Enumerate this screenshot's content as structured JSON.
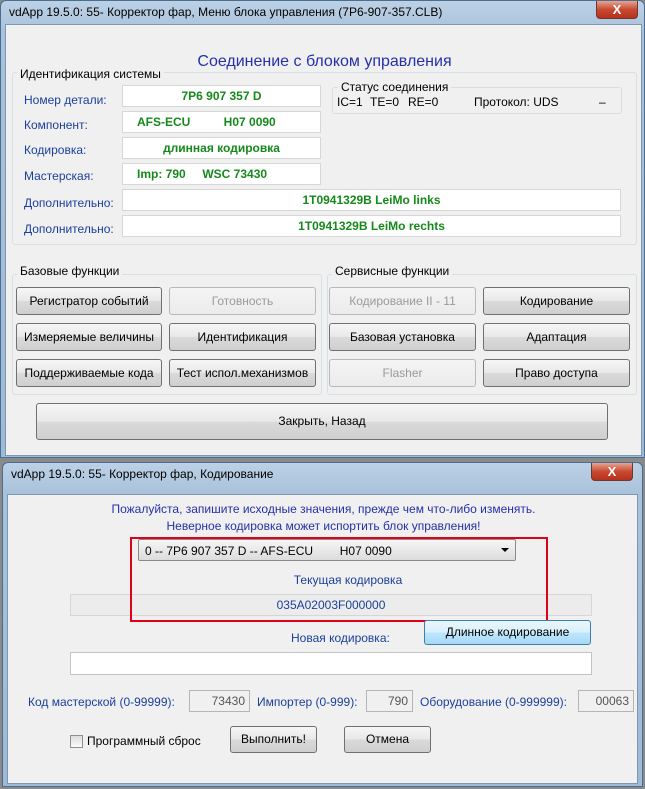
{
  "window1": {
    "title": "vdApp 19.5.0: 55- Корректор фар,  Меню блока управления (7P6-907-357.CLB)",
    "close": "X",
    "heading": "Соединение с блоком управления",
    "ident_group": "Идентификация системы",
    "status_group": "Статус соединения",
    "status_line": {
      "ic": "IC=1",
      "te": "TE=0",
      "re": "RE=0",
      "protocol": "Протокол: UDS",
      "dash": "–"
    },
    "fields": [
      {
        "label": "Номер детали:",
        "value": "7P6 907 357 D"
      },
      {
        "label": "Компонент:",
        "value": "AFS-ECU          H07 0090"
      },
      {
        "label": "Кодировка:",
        "value": "длинная кодировка"
      },
      {
        "label": "Мастерская:",
        "value": "Imp: 790     WSC 73430"
      },
      {
        "label": "Дополнительно:",
        "value": "1T0941329B LeiMo links"
      },
      {
        "label": "Дополнительно:",
        "value": "1T0941329B LeiMo rechts"
      }
    ],
    "basic_group": "Базовые функции",
    "service_group": "Сервисные функции",
    "buttons": {
      "event_log": "Регистратор событий",
      "readiness": "Готовность",
      "coding2": "Кодирование II - 11",
      "coding": "Кодирование",
      "measured": "Измеряемые величины",
      "identification": "Идентификация",
      "basic_setting": "Базовая установка",
      "adaptation": "Адаптация",
      "supported_codes": "Поддерживаемые кода",
      "actuator_test": "Тест испол.механизмов",
      "flasher": "Flasher",
      "access": "Право доступа",
      "close_back": "Закрыть, Назад"
    }
  },
  "window2": {
    "title": "vdApp 19.5.0: 55- Корректор фар,  Кодирование",
    "close": "X",
    "warning1": "Пожалуйста, запишите исходные значения, прежде чем что-либо изменять.",
    "warning2": "Неверное кодировка может испортить блок управления!",
    "dropdown": "0 -- 7P6 907 357 D -- AFS-ECU        H07 0090",
    "current_label": "Текущая кодировка",
    "current_value": "035A02003F000000",
    "new_label": "Новая кодировка:",
    "long_coding_button": "Длинное кодирование",
    "new_value": "",
    "workshop_label": "Код мастерской (0-99999):",
    "workshop_value": "73430",
    "importer_label": "Импортер (0-999):",
    "importer_value": "790",
    "equipment_label": "Оборудование (0-999999):",
    "equipment_value": "00063",
    "soft_reset": "Программный сброс",
    "soft_reset_checked": false,
    "execute": "Выполнить!",
    "cancel": "Отмена"
  }
}
